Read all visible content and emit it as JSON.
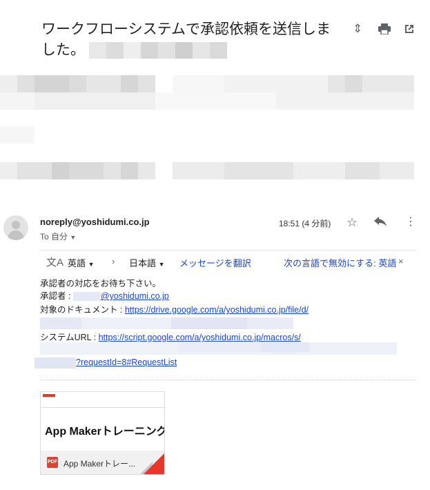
{
  "subject": {
    "text": "ワークフローシステムで承認依頼を送信しました。"
  },
  "header_icons": {
    "expand": "unfold-icon",
    "print": "print-icon",
    "popout": "open-in-new-window-icon"
  },
  "message": {
    "sender": "noreply@yoshidumi.co.jp",
    "to_label": "To 自分",
    "time": "18:51 (4 分前)",
    "icons": [
      "star-icon",
      "reply-icon",
      "more-vert-icon"
    ]
  },
  "translate_bar": {
    "source_lang": "英語",
    "target_lang": "日本語",
    "translate_link": "メッセージを翻訳",
    "disable_link": "次の言語で無効にする: 英語",
    "close": "×"
  },
  "body": {
    "line1": "承認者の対応をお待ち下さい。",
    "approver_label": "承認者 : ",
    "approver_domain": "@yoshidumi.co.jp",
    "doc_label": "対象のドキュメント : ",
    "doc_url": "https://drive.google.com/a/yoshidumi.co.jp/file/d/",
    "system_label": "システムURL : ",
    "system_url": "https://script.google.com/a/yoshidumi.co.jp/macros/s/",
    "request_suffix": "?requestId=8#RequestList"
  },
  "attachment": {
    "preview_title": "App Makerトレーニング",
    "file_type": "PDF",
    "file_name": "App Makerトレー..."
  }
}
